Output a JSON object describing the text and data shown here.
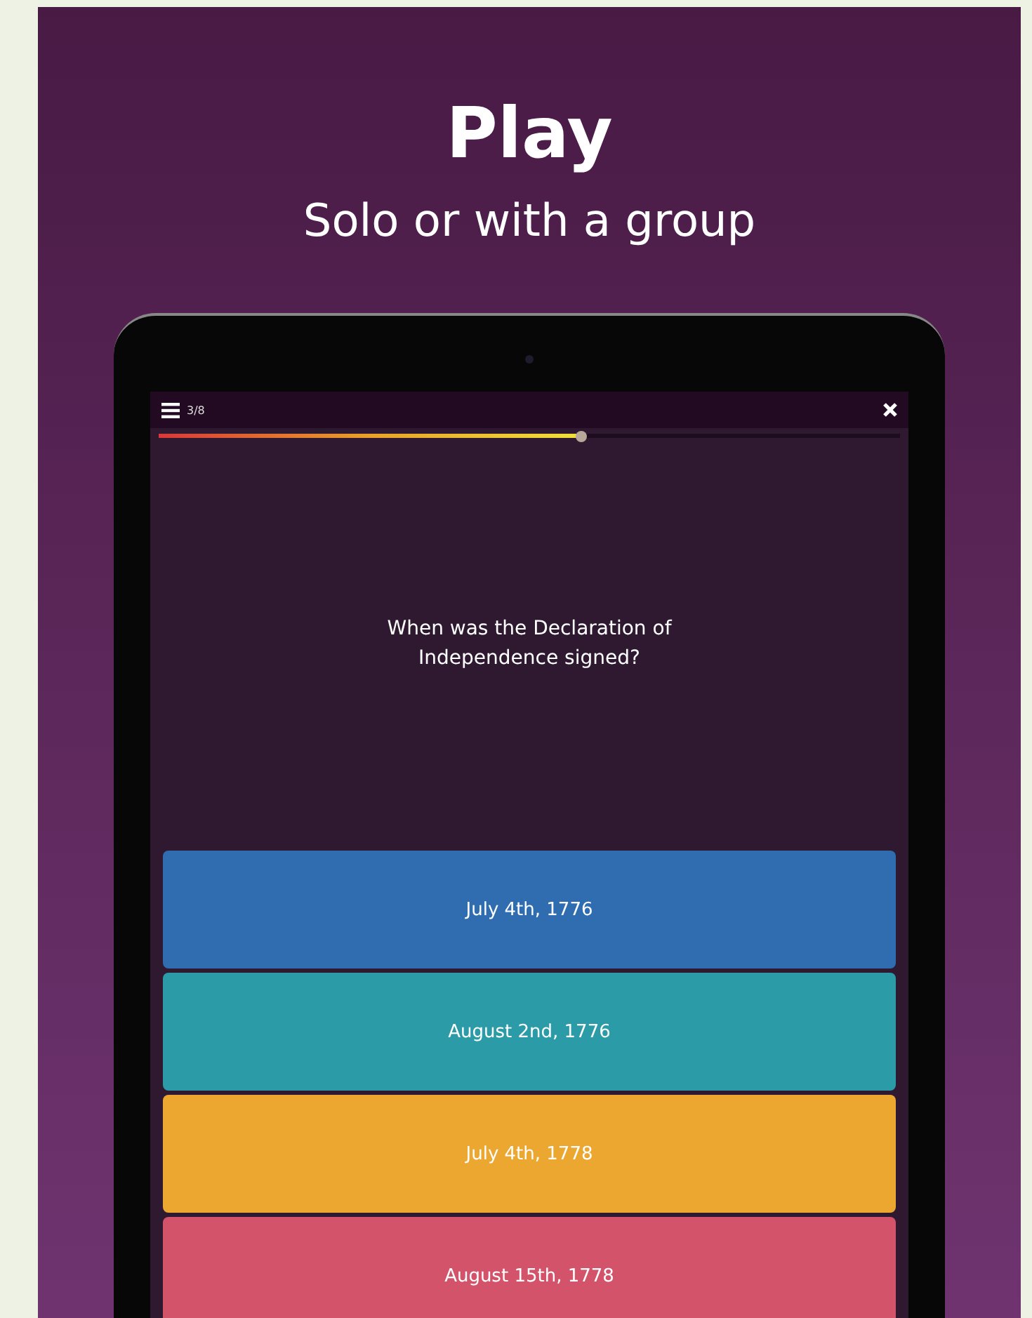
{
  "heading": {
    "title": "Play",
    "subtitle": "Solo or with a group"
  },
  "quiz": {
    "counter": "3/8",
    "progress": {
      "level": 0.57
    },
    "question": "When was the Declaration of Independence signed?",
    "answers": [
      {
        "label": "July 4th, 1776",
        "color": "#2f6db0"
      },
      {
        "label": "August 2nd, 1776",
        "color": "#2a9ba7"
      },
      {
        "label": "July 4th, 1778",
        "color": "#eba72f"
      },
      {
        "label": "August 15th, 1778",
        "color": "#d2536a"
      }
    ]
  }
}
